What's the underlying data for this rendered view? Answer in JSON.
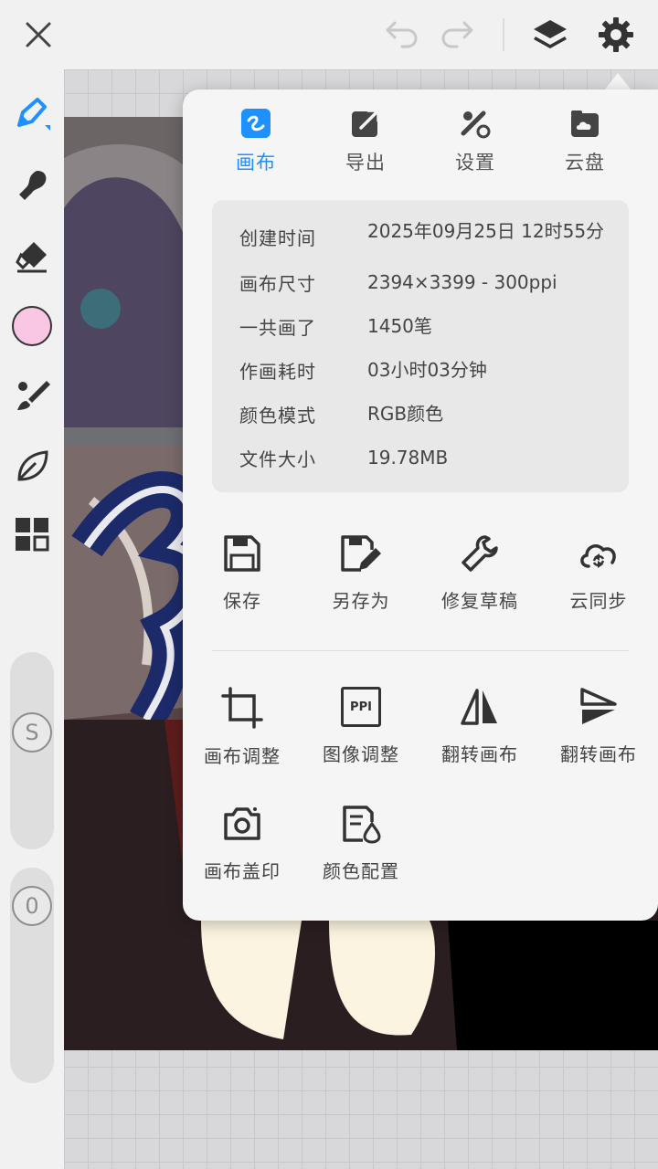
{
  "topbar": {
    "icons": [
      "close-icon",
      "undo-icon",
      "redo-icon",
      "layers-icon",
      "gear-icon"
    ]
  },
  "toolbar": {
    "tools": [
      "brush-icon",
      "smudge-icon",
      "eraser-icon",
      "color-swatch",
      "brush-settings-icon",
      "leaf-icon",
      "grid-icon"
    ],
    "current_color": "#f9c6e3",
    "accent": "#1e90ff",
    "size_slider_label": "S",
    "opacity_slider_label": "0"
  },
  "popup": {
    "tabs": [
      {
        "label": "画布",
        "icon": "canvas-icon",
        "active": true
      },
      {
        "label": "导出",
        "icon": "export-icon",
        "active": false
      },
      {
        "label": "设置",
        "icon": "settings-tools-icon",
        "active": false
      },
      {
        "label": "云盘",
        "icon": "cloud-disk-icon",
        "active": false
      }
    ],
    "info": [
      {
        "key": "创建时间",
        "value": "2025年09月25日 12时55分"
      },
      {
        "key": "画布尺寸",
        "value": "2394×3399 - 300ppi"
      },
      {
        "key": "一共画了",
        "value": "1450笔"
      },
      {
        "key": "作画耗时",
        "value": "03小时03分钟"
      },
      {
        "key": "颜色模式",
        "value": "RGB颜色"
      },
      {
        "key": "文件大小",
        "value": "19.78MB"
      }
    ],
    "actions_row1": [
      {
        "label": "保存",
        "icon": "save-icon"
      },
      {
        "label": "另存为",
        "icon": "save-as-icon"
      },
      {
        "label": "修复草稿",
        "icon": "repair-icon"
      },
      {
        "label": "云同步",
        "icon": "cloud-sync-icon"
      }
    ],
    "actions_row2": [
      {
        "label": "画布调整",
        "icon": "crop-icon"
      },
      {
        "label": "图像调整",
        "icon": "ppi-icon"
      },
      {
        "label": "翻转画布",
        "icon": "flip-horizontal-icon"
      },
      {
        "label": "翻转画布",
        "icon": "flip-vertical-icon"
      }
    ],
    "actions_row3": [
      {
        "label": "画布盖印",
        "icon": "camera-icon"
      },
      {
        "label": "颜色配置",
        "icon": "color-profile-icon"
      }
    ],
    "ppi_badge": "PPI"
  }
}
